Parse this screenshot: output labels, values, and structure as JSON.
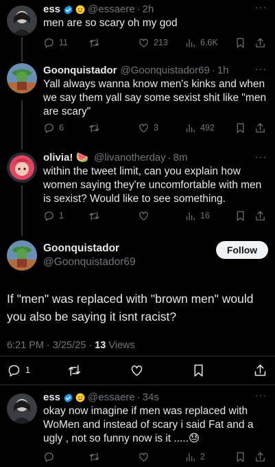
{
  "tweets": [
    {
      "name": "ess",
      "handle": "@essaere",
      "time": "2h",
      "text": "men are so scary oh my god",
      "replies": "11",
      "retweets": "",
      "likes": "213",
      "views": "6.6K"
    },
    {
      "name": "Goonquistador",
      "handle": "@Goonquistador69",
      "time": "1h",
      "text": "Yall always wanna know men's kinks and when we say them yall say some sexist shit like \"men are scary\"",
      "replies": "6",
      "retweets": "",
      "likes": "3",
      "views": "492"
    },
    {
      "name": "olivia! 🍉",
      "handle": "@livanotherday",
      "time": "8m",
      "text": "within the tweet limit, can you explain how women saying they're uncomfortable with men is sexist?  Would like to see something.",
      "replies": "1",
      "retweets": "",
      "likes": "",
      "views": "16"
    }
  ],
  "focused": {
    "name": "Goonquistador",
    "handle": "@Goonquistador69",
    "follow_label": "Follow",
    "text": "If \"men\" was replaced with \"brown men\" would you also be saying it isnt racist?",
    "timestamp": "6:21 PM · 3/25/25 · ",
    "views_count": "13",
    "views_label": " Views",
    "replies": "1"
  },
  "reply": {
    "name": "ess",
    "handle": "@essaere",
    "time": "34s",
    "text": "okay now imagine if men was replaced with WoMen and instead of scary i said Fat and a ugly , not so funny now is it .....😓",
    "views": "2"
  },
  "separator": "·",
  "more_glyph": "···",
  "colors": {
    "background": "#000000",
    "text": "#e7e9ea",
    "muted": "#71767b",
    "verified": "#1d9bf0",
    "follow_bg": "#eff3f4"
  },
  "icons": [
    "reply-icon",
    "retweet-icon",
    "like-icon",
    "views-icon",
    "bookmark-icon",
    "share-icon",
    "more-icon",
    "verified-badge-icon"
  ]
}
